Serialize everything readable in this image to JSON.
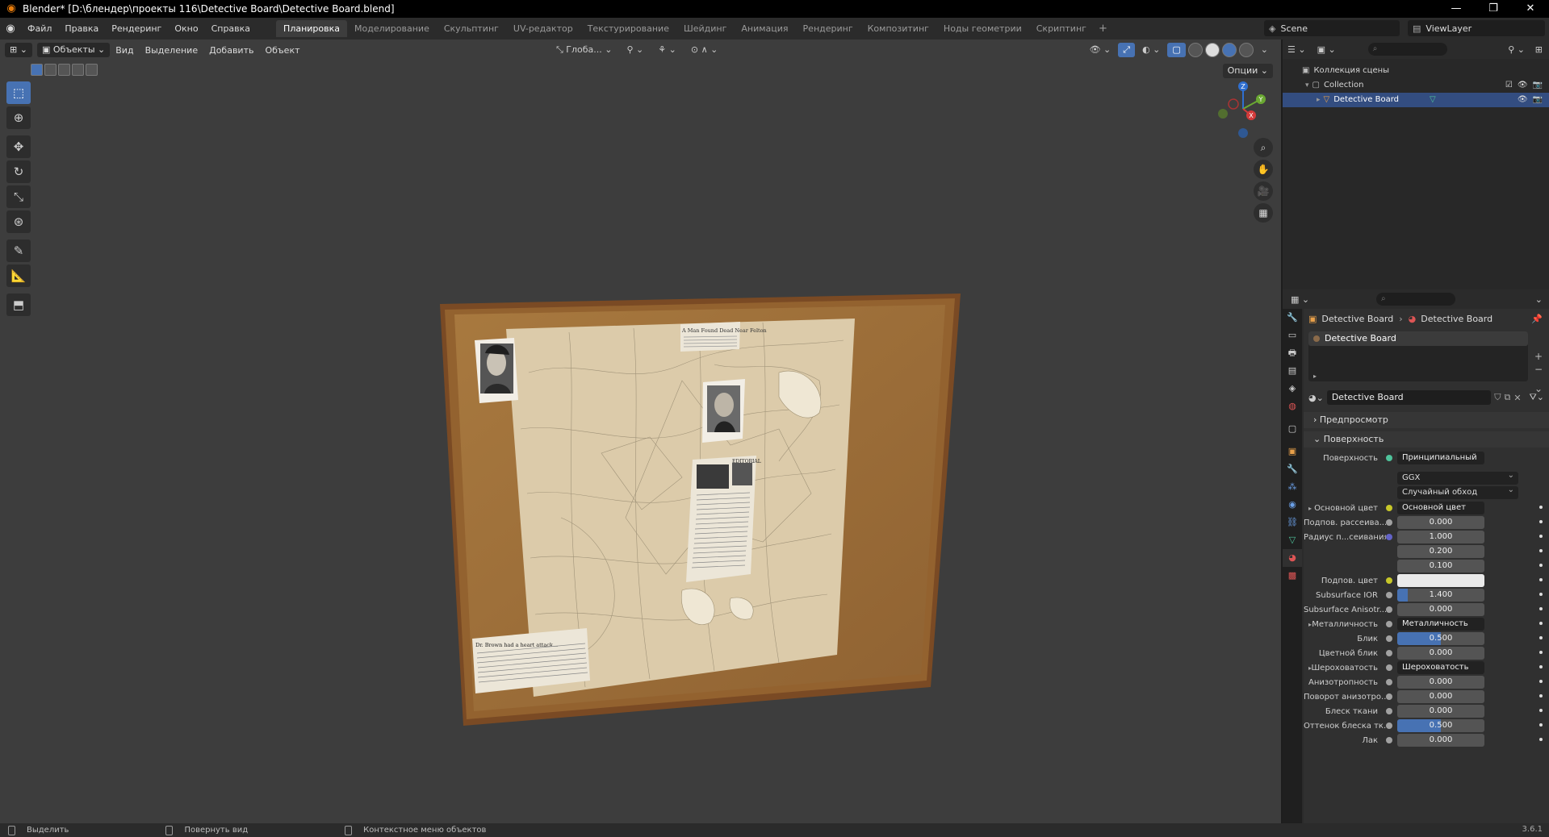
{
  "window": {
    "title": "Blender* [D:\\блендер\\проекты 116\\Detective Board\\Detective Board.blend]",
    "controls": [
      "—",
      "❐",
      "✕"
    ]
  },
  "menubar": {
    "items": [
      "Файл",
      "Правка",
      "Рендеринг",
      "Окно",
      "Справка"
    ],
    "workspaces": [
      "Планировка",
      "Моделирование",
      "Скульптинг",
      "UV-редактор",
      "Текстурирование",
      "Шейдинг",
      "Анимация",
      "Рендеринг",
      "Композитинг",
      "Ноды геометрии",
      "Скриптинг"
    ],
    "active_workspace": "Планировка",
    "add_label": "+",
    "scene": "Scene",
    "view_layer": "ViewLayer"
  },
  "viewport": {
    "mode": "Объекты",
    "menus": [
      "Вид",
      "Выделение",
      "Добавить",
      "Объект"
    ],
    "orientation": "Глоба...",
    "options_label": "Опции",
    "gizmo_axes": [
      "Z",
      "Y",
      "X"
    ]
  },
  "board": {
    "headline_top_right": "A Man Found Dead Near Felton",
    "headline_bottom_left": "Dr. Brown had a heart attack...",
    "headline_right": "EDITORIAL",
    "colors": {
      "frame": "#8a5a30",
      "cork": "#a07440",
      "paper": "#d9c8a5"
    }
  },
  "outliner": {
    "scene_collection": "Коллекция сцены",
    "collection": "Collection",
    "object": "Detective Board"
  },
  "properties": {
    "breadcrumb_object": "Detective Board",
    "breadcrumb_material": "Detective Board",
    "material_slot": "Detective Board",
    "material_name": "Detective Board",
    "panel_preview": "Предпросмотр",
    "panel_surface": "Поверхность",
    "surface_label": "Поверхность",
    "surface_value": "Принципиальный BSDF",
    "distribution": "GGX",
    "subsurface_method": "Случайный обход",
    "rows": [
      {
        "label": "Основной цвет",
        "value": "Основной цвет",
        "type": "link",
        "sock": "yellow",
        "arrow": true
      },
      {
        "label": "Подпов. рассеива...",
        "value": "0.000",
        "type": "num",
        "sock": "gray",
        "fill": 0
      },
      {
        "label": "Радиус п...сеивания",
        "value": "1.000",
        "type": "num",
        "sock": "blue",
        "fill": 0
      },
      {
        "label": "",
        "value": "0.200",
        "type": "num",
        "sock": "",
        "fill": 0
      },
      {
        "label": "",
        "value": "0.100",
        "type": "num",
        "sock": "",
        "fill": 0
      },
      {
        "label": "Подпов. цвет",
        "value": "",
        "type": "color",
        "sock": "yellow",
        "fill": 0
      },
      {
        "label": "Subsurface IOR",
        "value": "1.400",
        "type": "num",
        "sock": "gray",
        "fill": 0.12
      },
      {
        "label": "Subsurface Anisotr...",
        "value": "0.000",
        "type": "num",
        "sock": "gray",
        "fill": 0
      },
      {
        "label": "Металличность",
        "value": "Металличность",
        "type": "link",
        "sock": "gray",
        "arrow": true
      },
      {
        "label": "Блик",
        "value": "0.500",
        "type": "num",
        "sock": "gray",
        "fill": 0.5
      },
      {
        "label": "Цветной блик",
        "value": "0.000",
        "type": "num",
        "sock": "gray",
        "fill": 0
      },
      {
        "label": "Шероховатость",
        "value": "Шероховатость",
        "type": "link",
        "sock": "gray",
        "arrow": true
      },
      {
        "label": "Анизотропность",
        "value": "0.000",
        "type": "num",
        "sock": "gray",
        "fill": 0
      },
      {
        "label": "Поворот анизотро...",
        "value": "0.000",
        "type": "num",
        "sock": "gray",
        "fill": 0
      },
      {
        "label": "Блеск ткани",
        "value": "0.000",
        "type": "num",
        "sock": "gray",
        "fill": 0
      },
      {
        "label": "Оттенок блеска тк...",
        "value": "0.500",
        "type": "num",
        "sock": "gray",
        "fill": 0.5
      },
      {
        "label": "Лак",
        "value": "0.000",
        "type": "num",
        "sock": "gray",
        "fill": 0
      }
    ]
  },
  "statusbar": {
    "select": "Выделить",
    "rotate": "Повернуть вид",
    "context": "Контекстное меню объектов",
    "version": "3.6.1"
  }
}
